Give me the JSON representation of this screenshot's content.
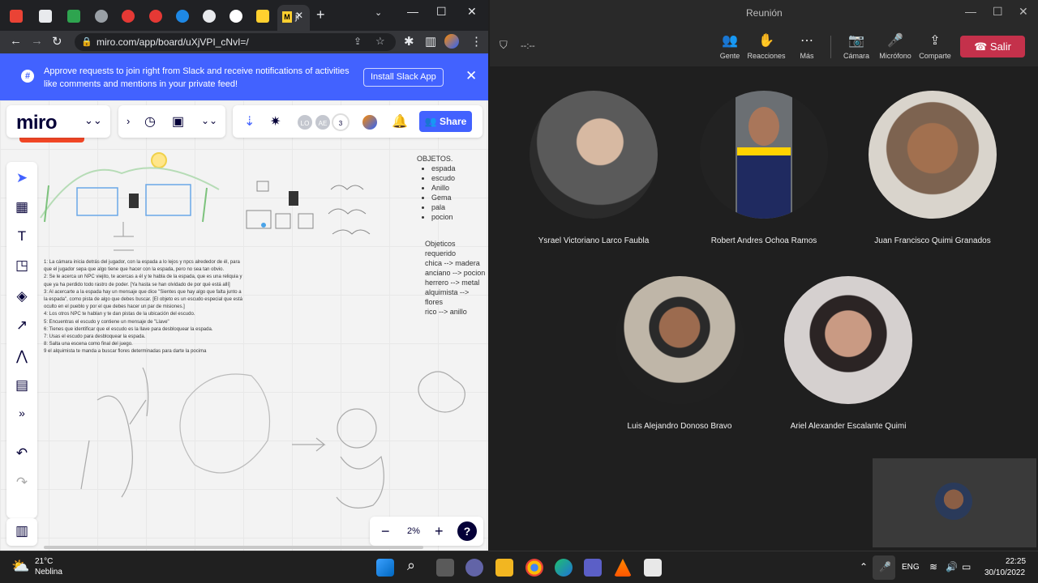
{
  "browser": {
    "tab_active_label": "ji",
    "url": "miro.com/app/board/uXjVPI_cNvI=/"
  },
  "banner": {
    "message": "Approve requests to join right from Slack and receive notifications of activities like comments and mentions in your private feed!",
    "install_label": "Install Slack App"
  },
  "miro": {
    "logo": "miro",
    "avatars": [
      "LO",
      "AE"
    ],
    "collaborator_count": "3",
    "share_label": "Share",
    "zoom": "2%",
    "help": "?",
    "board": {
      "objetos_title": "OBJETOS.",
      "objetos": [
        "espada",
        "escudo",
        "Anillo",
        "Gema",
        "pala",
        "pocion"
      ],
      "requeridos": [
        "Objeticos requerido",
        "chica --> madera",
        "anciano --> pocion",
        "herrero --> metal",
        "alquimista --> flores",
        "rico --> anillo"
      ],
      "story": [
        "1: La cámara inicia detrás del jugador, con la espada a lo lejos y npcs alrededor de él, para",
        "que el jugador sepa que algo tiene que hacer con la espada, pero no sea tan obvio.",
        "2: Se le acerca un NPC viejito, te acercas a él y te habla de la espada, que es una reliquia y",
        "que ya ha perdido todo rastro de poder. [Ya hasta se han olvidado de por qué está allí]",
        "3: Al acercarte a la espada hay un mensaje que dice \"Sientes que hay algo que falta junto a",
        "la espada\", como pista de algo que debes buscar. [El objeto es un escudo especial que está",
        "oculto en el pueblo y por el que debes hacer un par de misiones.]",
        "4: Los otros NPC te hablan y te dan pistas de la ubicación del escudo.",
        "5: Encuentras el escudo y contiene un mensaje de \"Llave\"",
        "6: Tienes que identificar que el escudo es la llave para desbloquear la espada.",
        "7: Usas el escudo para desbloquear la espada.",
        "8: Salta una escena como final del juego.",
        "9 el alquimista te manda a buscar flores determinadas para darte la pocima"
      ]
    }
  },
  "teams": {
    "window_title": "Reunión",
    "timer": "--:--",
    "toolbar": {
      "people": "Gente",
      "reactions": "Reacciones",
      "more": "Más",
      "camera": "Cámara",
      "mic": "Micrófono",
      "share": "Comparte",
      "leave": "Salir"
    },
    "participants": [
      "Ysrael Victoriano Larco Faubla",
      "Robert Andres Ochoa Ramos",
      "Juan Francisco Quimi Granados",
      "Luis Alejandro Donoso Bravo",
      "Ariel Alexander Escalante Quimi"
    ]
  },
  "taskbar": {
    "temperature": "21°C",
    "weather": "Neblina",
    "lang": "ENG",
    "time": "22:25",
    "date": "30/10/2022"
  }
}
